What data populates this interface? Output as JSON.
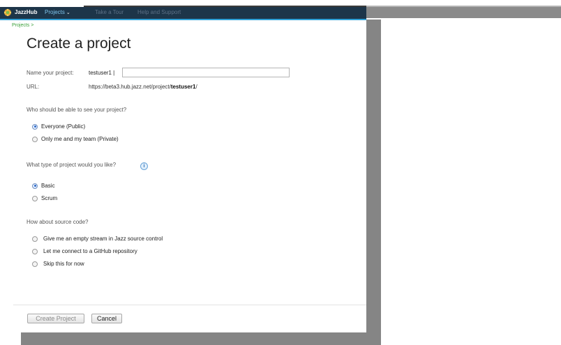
{
  "topbar": {
    "brand": "JazzHub",
    "projects_menu": "Projects",
    "take_tour": "Take a Tour",
    "help_support": "Help and Support"
  },
  "breadcrumb": "Projects >",
  "title": "Create a project",
  "name_field": {
    "label": "Name your project:",
    "prefix": "testuser1 |",
    "value": ""
  },
  "url": {
    "label": "URL:",
    "base": "https://beta3.hub.jazz.net/project/",
    "user": "testuser1",
    "suffix": "/"
  },
  "visibility": {
    "question": "Who should be able to see your project?",
    "options": [
      {
        "label": "Everyone (Public)",
        "checked": true
      },
      {
        "label": "Only me and my team (Private)",
        "checked": false
      }
    ]
  },
  "project_type": {
    "question": "What type of project would you like?",
    "options": [
      {
        "label": "Basic",
        "checked": true
      },
      {
        "label": "Scrum",
        "checked": false
      }
    ]
  },
  "source_code": {
    "question": "How about source code?",
    "options": [
      {
        "label": "Give me an empty stream in Jazz source control",
        "checked": false
      },
      {
        "label": "Let me connect to a GitHub repository",
        "checked": false
      },
      {
        "label": "Skip this for now",
        "checked": false
      }
    ]
  },
  "buttons": {
    "create": "Create Project",
    "cancel": "Cancel"
  },
  "colors": {
    "topbar": "#1d3549",
    "accent": "#2fa0d6",
    "breadcrumb": "#3aa03a"
  }
}
